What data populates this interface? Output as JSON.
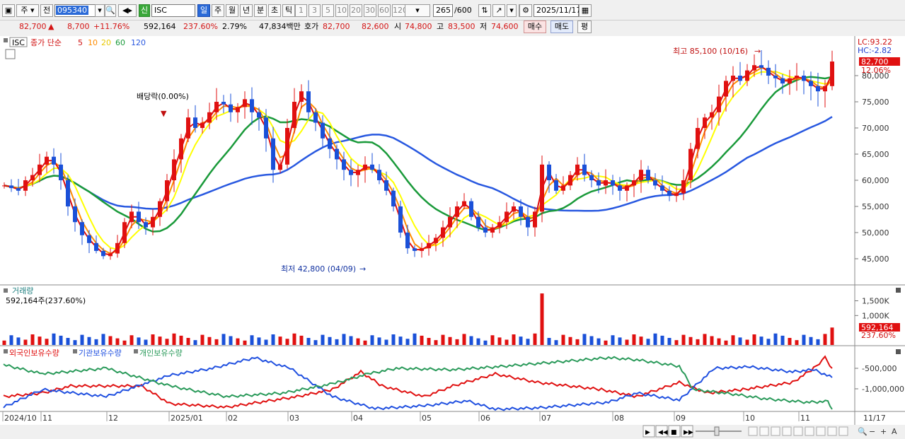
{
  "toolbar": {
    "type_label": "주",
    "prev_label": "전",
    "code": "095340",
    "name": "ISC",
    "credit_badge": "신",
    "periods": [
      "일",
      "주",
      "월",
      "년",
      "분",
      "초",
      "틱"
    ],
    "minutes": [
      "1",
      "3",
      "5",
      "10",
      "20",
      "30",
      "60",
      "120"
    ],
    "count": "265",
    "count_total": "/600",
    "date": "2025/11/17"
  },
  "quote": {
    "price": "82,700",
    "change_arrow": "▲",
    "change": "8,700",
    "change_pct": "+11.76%",
    "volume": "592,164",
    "volume_ratio": "237.60%",
    "turnover": "2.79%",
    "amount": "47,834백만",
    "ask_label": "호가",
    "ask": "82,700",
    "bid": "82,600",
    "open_label": "시",
    "open": "74,800",
    "high_label": "고",
    "high": "83,500",
    "low_label": "저",
    "low": "74,600",
    "buy_label": "매수",
    "sell_label": "매도",
    "eval_label": "평"
  },
  "legend": {
    "code": "ISC",
    "ma_prefix": "종가 단순",
    "ma5": "5",
    "ma10": "10",
    "ma20": "20",
    "ma60": "60",
    "ma120": "120"
  },
  "colors": {
    "up": "#e01010",
    "down": "#1a50d8",
    "ma5": "#e01010",
    "ma10": "#ff8c00",
    "ma20": "#ffff00",
    "ma60": "#1a9a3a",
    "ma120": "#2858e0",
    "foreign": "#e01010",
    "institution": "#2050e0",
    "individual": "#2a9a5a"
  },
  "annotations": {
    "high": "최고 85,100 (10/16)",
    "low": "최저 42,800 (04/09)",
    "dividend": "배당락(0.00%)",
    "lc": "LC:93.22",
    "hc": "HC:-2.82",
    "price_tag": "82,700",
    "pct_tag": "12.06%"
  },
  "volume_panel": {
    "title": "거래량",
    "value": "592,164주(237.60%)",
    "tag": "592,164",
    "pct_tag": "237.60%"
  },
  "holdings_panel": {
    "items": [
      "외국인보유수량",
      "기관보유수량",
      "개인보유수량"
    ]
  },
  "chart_data": {
    "type": "candlestick",
    "price_axis": {
      "ticks": [
        45000,
        50000,
        55000,
        60000,
        65000,
        70000,
        75000,
        80000
      ],
      "labels": [
        "45,000",
        "50,000",
        "55,000",
        "60,000",
        "65,000",
        "70,000",
        "75,000",
        "80,000"
      ]
    },
    "volume_axis": {
      "ticks": [
        1000000,
        1500000
      ],
      "labels": [
        "1,000K",
        "1,500K"
      ]
    },
    "holdings_axis": {
      "ticks": [
        -1000000,
        -500000
      ],
      "labels": [
        "-1,000,000",
        "-500,000"
      ]
    },
    "x_labels": [
      "2024/10",
      "11",
      "12",
      "2025/01",
      "02",
      "03",
      "04",
      "05",
      "06",
      "07",
      "08",
      "09",
      "10",
      "11",
      "11/17"
    ],
    "high": {
      "value": 85100,
      "date": "10/16"
    },
    "low": {
      "value": 42800,
      "date": "04/09"
    },
    "last_close": 82700,
    "last_volume": 592164,
    "closes": [
      59000,
      58500,
      58000,
      60000,
      61000,
      63000,
      64500,
      63000,
      60000,
      55000,
      52000,
      49500,
      48000,
      46500,
      45500,
      46000,
      48000,
      52000,
      54000,
      52000,
      51000,
      53000,
      56000,
      60000,
      64000,
      68000,
      72000,
      70000,
      71000,
      73000,
      75000,
      74500,
      73000,
      74000,
      75500,
      73000,
      72000,
      68000,
      62000,
      63000,
      70000,
      75000,
      77000,
      73000,
      71000,
      68000,
      66000,
      64000,
      62000,
      61000,
      62000,
      63000,
      62000,
      60000,
      58000,
      55000,
      50000,
      47000,
      46500,
      47000,
      48000,
      49000,
      51000,
      53000,
      55000,
      56000,
      53000,
      51000,
      50000,
      51000,
      52000,
      54000,
      55000,
      53000,
      51000,
      54000,
      63000,
      60000,
      58000,
      59000,
      61000,
      63000,
      61000,
      60000,
      59000,
      60000,
      59000,
      58000,
      59000,
      60000,
      62000,
      60000,
      59000,
      58000,
      57000,
      57500,
      60000,
      66000,
      70000,
      72000,
      73000,
      76000,
      79000,
      80000,
      79000,
      81000,
      82000,
      81500,
      80000,
      79500,
      78500,
      79500,
      80000,
      79000,
      78000,
      77000,
      78000,
      82700
    ]
  }
}
